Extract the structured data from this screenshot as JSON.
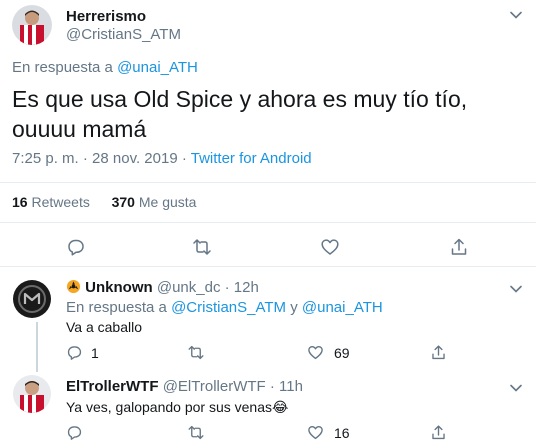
{
  "main_tweet": {
    "name": "Herrerismo",
    "handle": "@CristianS_ATM",
    "reply_prefix": "En respuesta a",
    "reply_to": "@unai_ATH",
    "text": "Es que usa Old Spice y ahora es muy tío tío, ouuuu mamá",
    "time_date": "7:25 p. m. · 28 nov. 2019 ·",
    "source": "Twitter for Android",
    "retweets_count": "16",
    "retweets_label": "Retweets",
    "likes_count": "370",
    "likes_label": "Me gusta"
  },
  "replies": [
    {
      "name": "Unknown",
      "handle": "@unk_dc",
      "time": "· 12h",
      "reply_prefix": "En respuesta a",
      "reply_to_1": "@CristianS_ATM",
      "reply_joiner": "y",
      "reply_to_2": "@unai_ATH",
      "text": "Va a caballo",
      "reply_count": "1",
      "like_count": "69"
    },
    {
      "name": "ElTrollerWTF",
      "handle": "@ElTrollerWTF",
      "time": "· 11h",
      "text": "Ya ves, galopando por sus venas",
      "emoji": "😂",
      "like_count": "16"
    }
  ],
  "icons": [
    "reply-icon",
    "retweet-icon",
    "like-icon",
    "share-icon",
    "caret-down-icon",
    "verified-hazard-icon"
  ],
  "colors": {
    "link": "#1b95e0",
    "secondary": "#657786",
    "text": "#14171a",
    "divider": "#e6ecf0"
  }
}
